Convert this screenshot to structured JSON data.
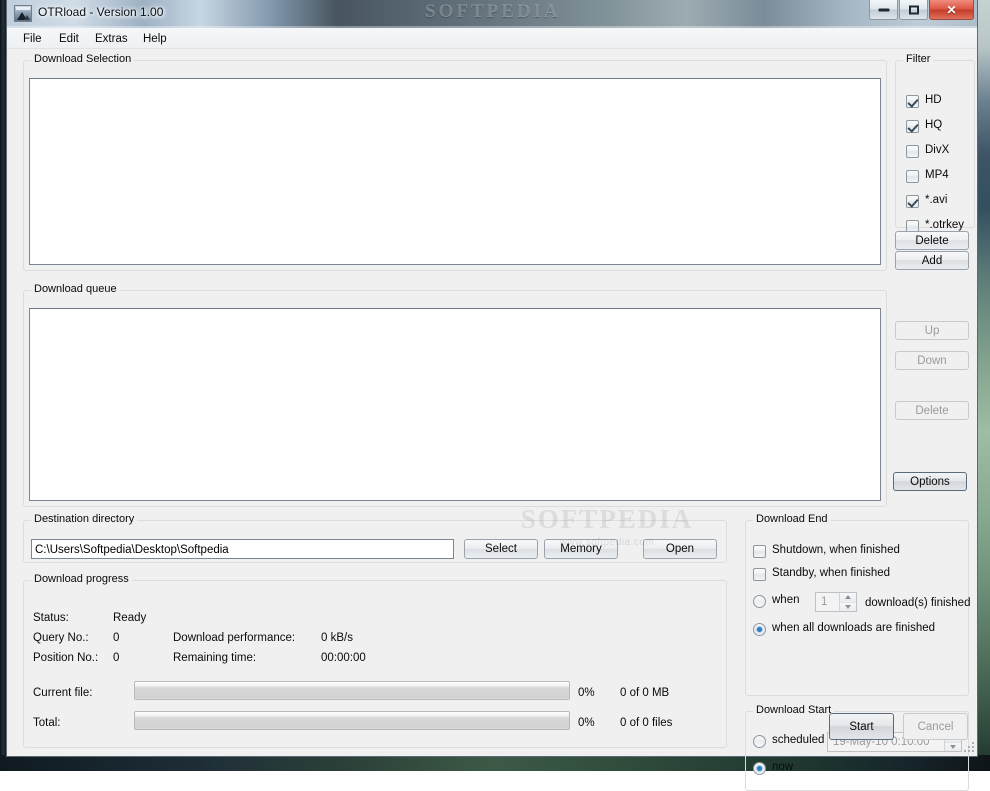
{
  "window": {
    "title": "OTRload - Version 1.00",
    "glass_watermark": "SOFTPEDIA",
    "icon": "app-icon",
    "minimize_label": "Minimize",
    "maximize_label": "Restore",
    "close_label": "Close"
  },
  "menu": {
    "items": [
      {
        "label": "File"
      },
      {
        "label": "Edit"
      },
      {
        "label": "Extras"
      },
      {
        "label": "Help"
      }
    ]
  },
  "download_selection": {
    "legend": "Download Selection",
    "list_items": []
  },
  "filter": {
    "legend": "Filter",
    "items": [
      {
        "label": "HD",
        "checked": true
      },
      {
        "label": "HQ",
        "checked": true
      },
      {
        "label": "DivX",
        "checked": false
      },
      {
        "label": "MP4",
        "checked": false
      },
      {
        "label": "*.avi",
        "checked": true
      },
      {
        "label": "*.otrkey",
        "checked": false
      }
    ],
    "delete_label": "Delete",
    "add_label": "Add"
  },
  "download_queue": {
    "legend": "Download queue",
    "list_items": [],
    "up_label": "Up",
    "down_label": "Down",
    "delete_label": "Delete",
    "options_label": "Options"
  },
  "destination": {
    "legend": "Destination directory",
    "path": "C:\\Users\\Softpedia\\Desktop\\Softpedia",
    "select_label": "Select",
    "memory_label": "Memory",
    "open_label": "Open"
  },
  "progress": {
    "legend": "Download progress",
    "status_label": "Status:",
    "status_value": "Ready",
    "query_label": "Query No.:",
    "query_value": "0",
    "position_label": "Position No.:",
    "position_value": "0",
    "performance_label": "Download performance:",
    "performance_value": "0 kB/s",
    "remaining_label": "Remaining time:",
    "remaining_value": "00:00:00",
    "current_file_label": "Current file:",
    "current_file_percent": "0%",
    "current_file_amount": "0 of 0 MB",
    "total_label": "Total:",
    "total_percent": "0%",
    "total_amount": "0 of 0 files"
  },
  "download_end": {
    "legend": "Download End",
    "shutdown_label": "Shutdown, when finished",
    "shutdown_checked": false,
    "standby_label": "Standby, when finished",
    "standby_checked": false,
    "when_label": "when",
    "when_selected": false,
    "count_value": "1",
    "downloads_finished_label": "download(s) finished",
    "all_label": "when all downloads are finished",
    "all_selected": true
  },
  "download_start": {
    "legend": "Download Start",
    "scheduled_label": "scheduled",
    "scheduled_selected": false,
    "scheduled_value": "19-May-10 0:10:00",
    "now_label": "now",
    "now_selected": true,
    "start_label": "Start",
    "cancel_label": "Cancel"
  },
  "watermark": {
    "big": "SOFTPEDIA",
    "small": "www.softpedia.com"
  },
  "colors": {
    "window_bg": "#f0f0f0",
    "accent": "#2b7fc4",
    "close_button": "#c33c29",
    "field_bg": "#ffffff"
  }
}
